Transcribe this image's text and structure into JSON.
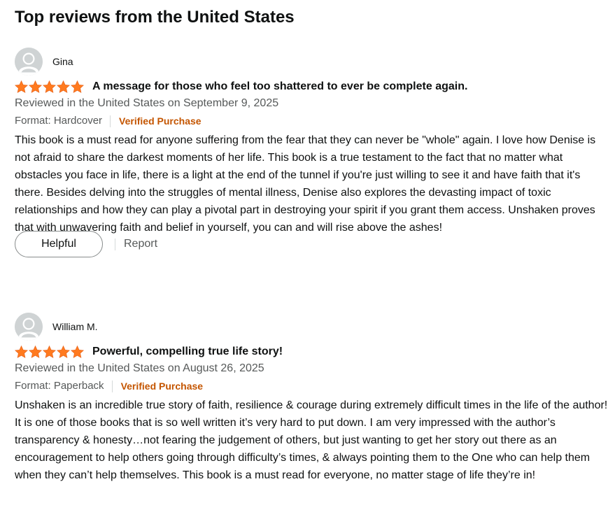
{
  "section": {
    "title": "Top reviews from the United States"
  },
  "colors": {
    "star": "#ff7a1f",
    "verified": "#c45500",
    "muted_text": "#565959",
    "avatar_bg": "#cfd3d4"
  },
  "icons": {
    "avatar": "default-user-avatar-icon",
    "star": "filled-star-icon"
  },
  "reviews": [
    {
      "reviewer": "Gina",
      "rating": 5,
      "rating_max": 5,
      "title": "A message for those who feel too shattered to ever be complete again.",
      "date": "Reviewed in the United States on September 9, 2025",
      "format": "Format: Hardcover",
      "verified": "Verified Purchase",
      "body": "This book is a must read for anyone suffering from the fear that they can never be \"whole\" again. I love how Denise is not afraid to share the darkest moments of her life. This book is a true testament to the fact that no matter what obstacles you face in life, there is a light at the end of the tunnel if you're just willing to see it and have faith that it's there. Besides delving into the struggles of mental illness, Denise also explores the devasting impact of toxic relationships and how they can play a pivotal part in destroying your spirit if you grant them access. Unshaken proves that with unwavering faith and belief in yourself, you can and will rise above the ashes!",
      "helpful_label": "Helpful",
      "report_label": "Report"
    },
    {
      "reviewer": "William M.",
      "rating": 5,
      "rating_max": 5,
      "title": "Powerful, compelling true life story!",
      "date": "Reviewed in the United States on August 26, 2025",
      "format": "Format: Paperback",
      "verified": "Verified Purchase",
      "body": "Unshaken is an incredible true story of faith, resilience & courage during extremely difficult times in the life of the author! It is one of those books that is so well written it’s very hard to put down. I am very impressed with the author’s transparency & honesty…not fearing the judgement of others, but just wanting to get her story out there as an encouragement to help others going through difficulty’s times, & always pointing them to the One who can help them when they can’t help themselves. This book is a must read for everyone, no matter stage of life they’re in!"
    }
  ]
}
